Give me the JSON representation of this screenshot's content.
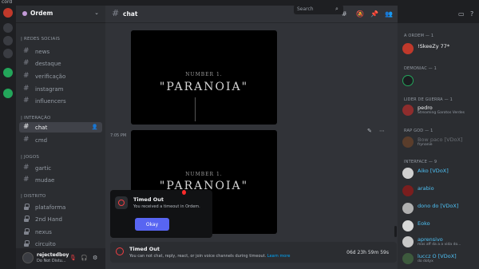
{
  "window": {
    "title": "cord"
  },
  "colors": {
    "accent": "#5865f2",
    "danger": "#f23f43",
    "link": "#00a8fc",
    "online": "#23a55a"
  },
  "server": {
    "name": "Ordem"
  },
  "categories": {
    "redes_sociais": "| REDES SOCIAIS",
    "interacao": "| INTERAÇÃO",
    "jogos": "| JOGOS",
    "distrito": "| DISTRITO"
  },
  "channels": {
    "news": "news",
    "destaque": "destaque",
    "verificacao": "verificação",
    "instagram": "instagram",
    "influencers": "influencers",
    "chat": "chat",
    "cmd": "cmd",
    "gartic": "gartic",
    "mudae": "mudae",
    "plataforma": "plataforma",
    "segunda_hand": "2nd Hand",
    "nexus": "nexus",
    "circuito": "circuito"
  },
  "user": {
    "name": "rejectedboy",
    "status": "Do Not Distu..."
  },
  "header": {
    "channel_name": "chat",
    "search_placeholder": "Search"
  },
  "messages": {
    "timestamp": "7:05 PM",
    "media_top_subtitle": "NUMBER 1.",
    "media_top_title": "\"PARANOIA\"",
    "media_bottom_subtitle": "NUMBER 1.",
    "media_bottom_title": "\"PARANOIA\""
  },
  "popup": {
    "title": "Timed Out",
    "message": "You received a timeout in Ordem.",
    "ok_label": "Okay"
  },
  "timeout_bar": {
    "title": "Timed Out",
    "message": "You can not chat, reply, react, or join voice channels during timeout.",
    "link": "Learn more",
    "remaining": "06d 23h 59m 59s"
  },
  "member_groups": [
    {
      "label": "A ORDEM — 1",
      "members": [
        {
          "name": "!SkeeZy 77*",
          "sub": "",
          "color": "#f2f3f5"
        }
      ]
    },
    {
      "label": "DEMONIAC — 1",
      "members": [
        {
          "name": "ᅠ",
          "sub": "",
          "color": "#c0392b"
        }
      ]
    },
    {
      "label": "LIDER DE GUERRA — 1",
      "members": [
        {
          "name": "pedro",
          "sub": "Streaming Garotos Verdes",
          "color": "#f2f3f5"
        }
      ]
    },
    {
      "label": "RAP GOD — 1",
      "members": [
        {
          "name": "Bow paco [VDoX]",
          "sub": "frynanie",
          "color": "#6b6f75"
        }
      ]
    },
    {
      "label": "INTERFACE — 9",
      "members": [
        {
          "name": "Aiko [VDoX]",
          "sub": "",
          "color": "#4fc3f7"
        },
        {
          "name": "arabio",
          "sub": "",
          "color": "#4fc3f7"
        },
        {
          "name": "dono do [VDoX]",
          "sub": "",
          "color": "#4fc3f7"
        },
        {
          "name": "Eoko",
          "sub": "",
          "color": "#4fc3f7"
        },
        {
          "name": "aprensivo",
          "sub": "mas aff da a a vida do...",
          "color": "#4fc3f7"
        },
        {
          "name": "luccz O [VDoX]",
          "sub": "do dotyx",
          "color": "#4fc3f7"
        }
      ]
    }
  ]
}
